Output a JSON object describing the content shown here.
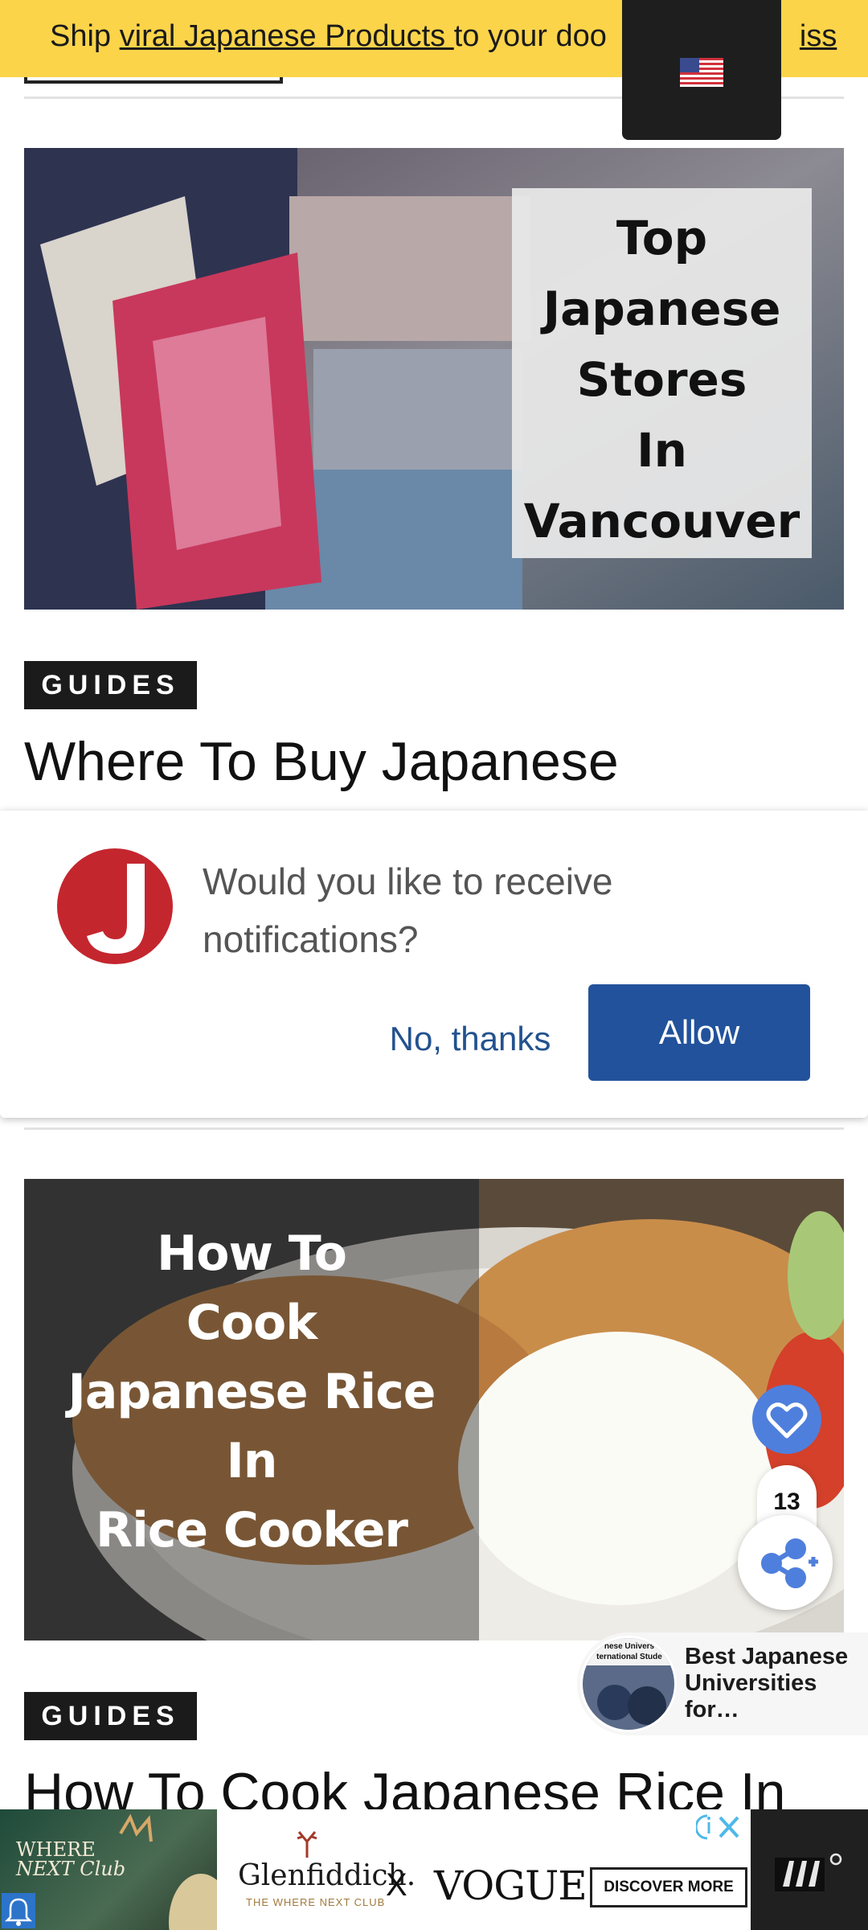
{
  "promo": {
    "prefix": "Ship ",
    "link": "viral Japanese Products ",
    "middle": "to your doo",
    "tail": "iss"
  },
  "articles": [
    {
      "image_text": [
        "Top",
        "Japanese",
        "Stores",
        "In",
        "Vancouver"
      ],
      "category": "GUIDES",
      "title": "Where To Buy Japanese"
    },
    {
      "image_text": [
        "How To",
        "Cook",
        "Japanese Rice",
        "In",
        "Rice Cooker"
      ],
      "category": "GUIDES",
      "title": "How To Cook Japanese Rice In"
    }
  ],
  "notification": {
    "message": "Would you like to receive notifications?",
    "decline_label": "No, thanks",
    "allow_label": "Allow"
  },
  "social": {
    "share_count": "13"
  },
  "related": {
    "title": "Best Japanese Universities for…",
    "thumb_text": "nese Univers ternational Stude"
  },
  "ad": {
    "left_text_1": "WHERE",
    "left_text_2": "NEXT Club",
    "brand": "Glenfiddich.",
    "brand_sub": "THE WHERE NEXT CLUB",
    "x": "X",
    "partner": "VOGUE",
    "cta": "DISCOVER MORE"
  },
  "colors": {
    "promo_bg": "#fbd44a",
    "allow_bg": "#22529b",
    "heart_bg": "#4f7fdd",
    "badge_bg": "#1b1b1b"
  },
  "icons": {
    "flag": "us-flag-icon",
    "heart": "heart-icon",
    "share": "share-icon",
    "close": "ad-close-icon",
    "bell": "bell-icon"
  }
}
